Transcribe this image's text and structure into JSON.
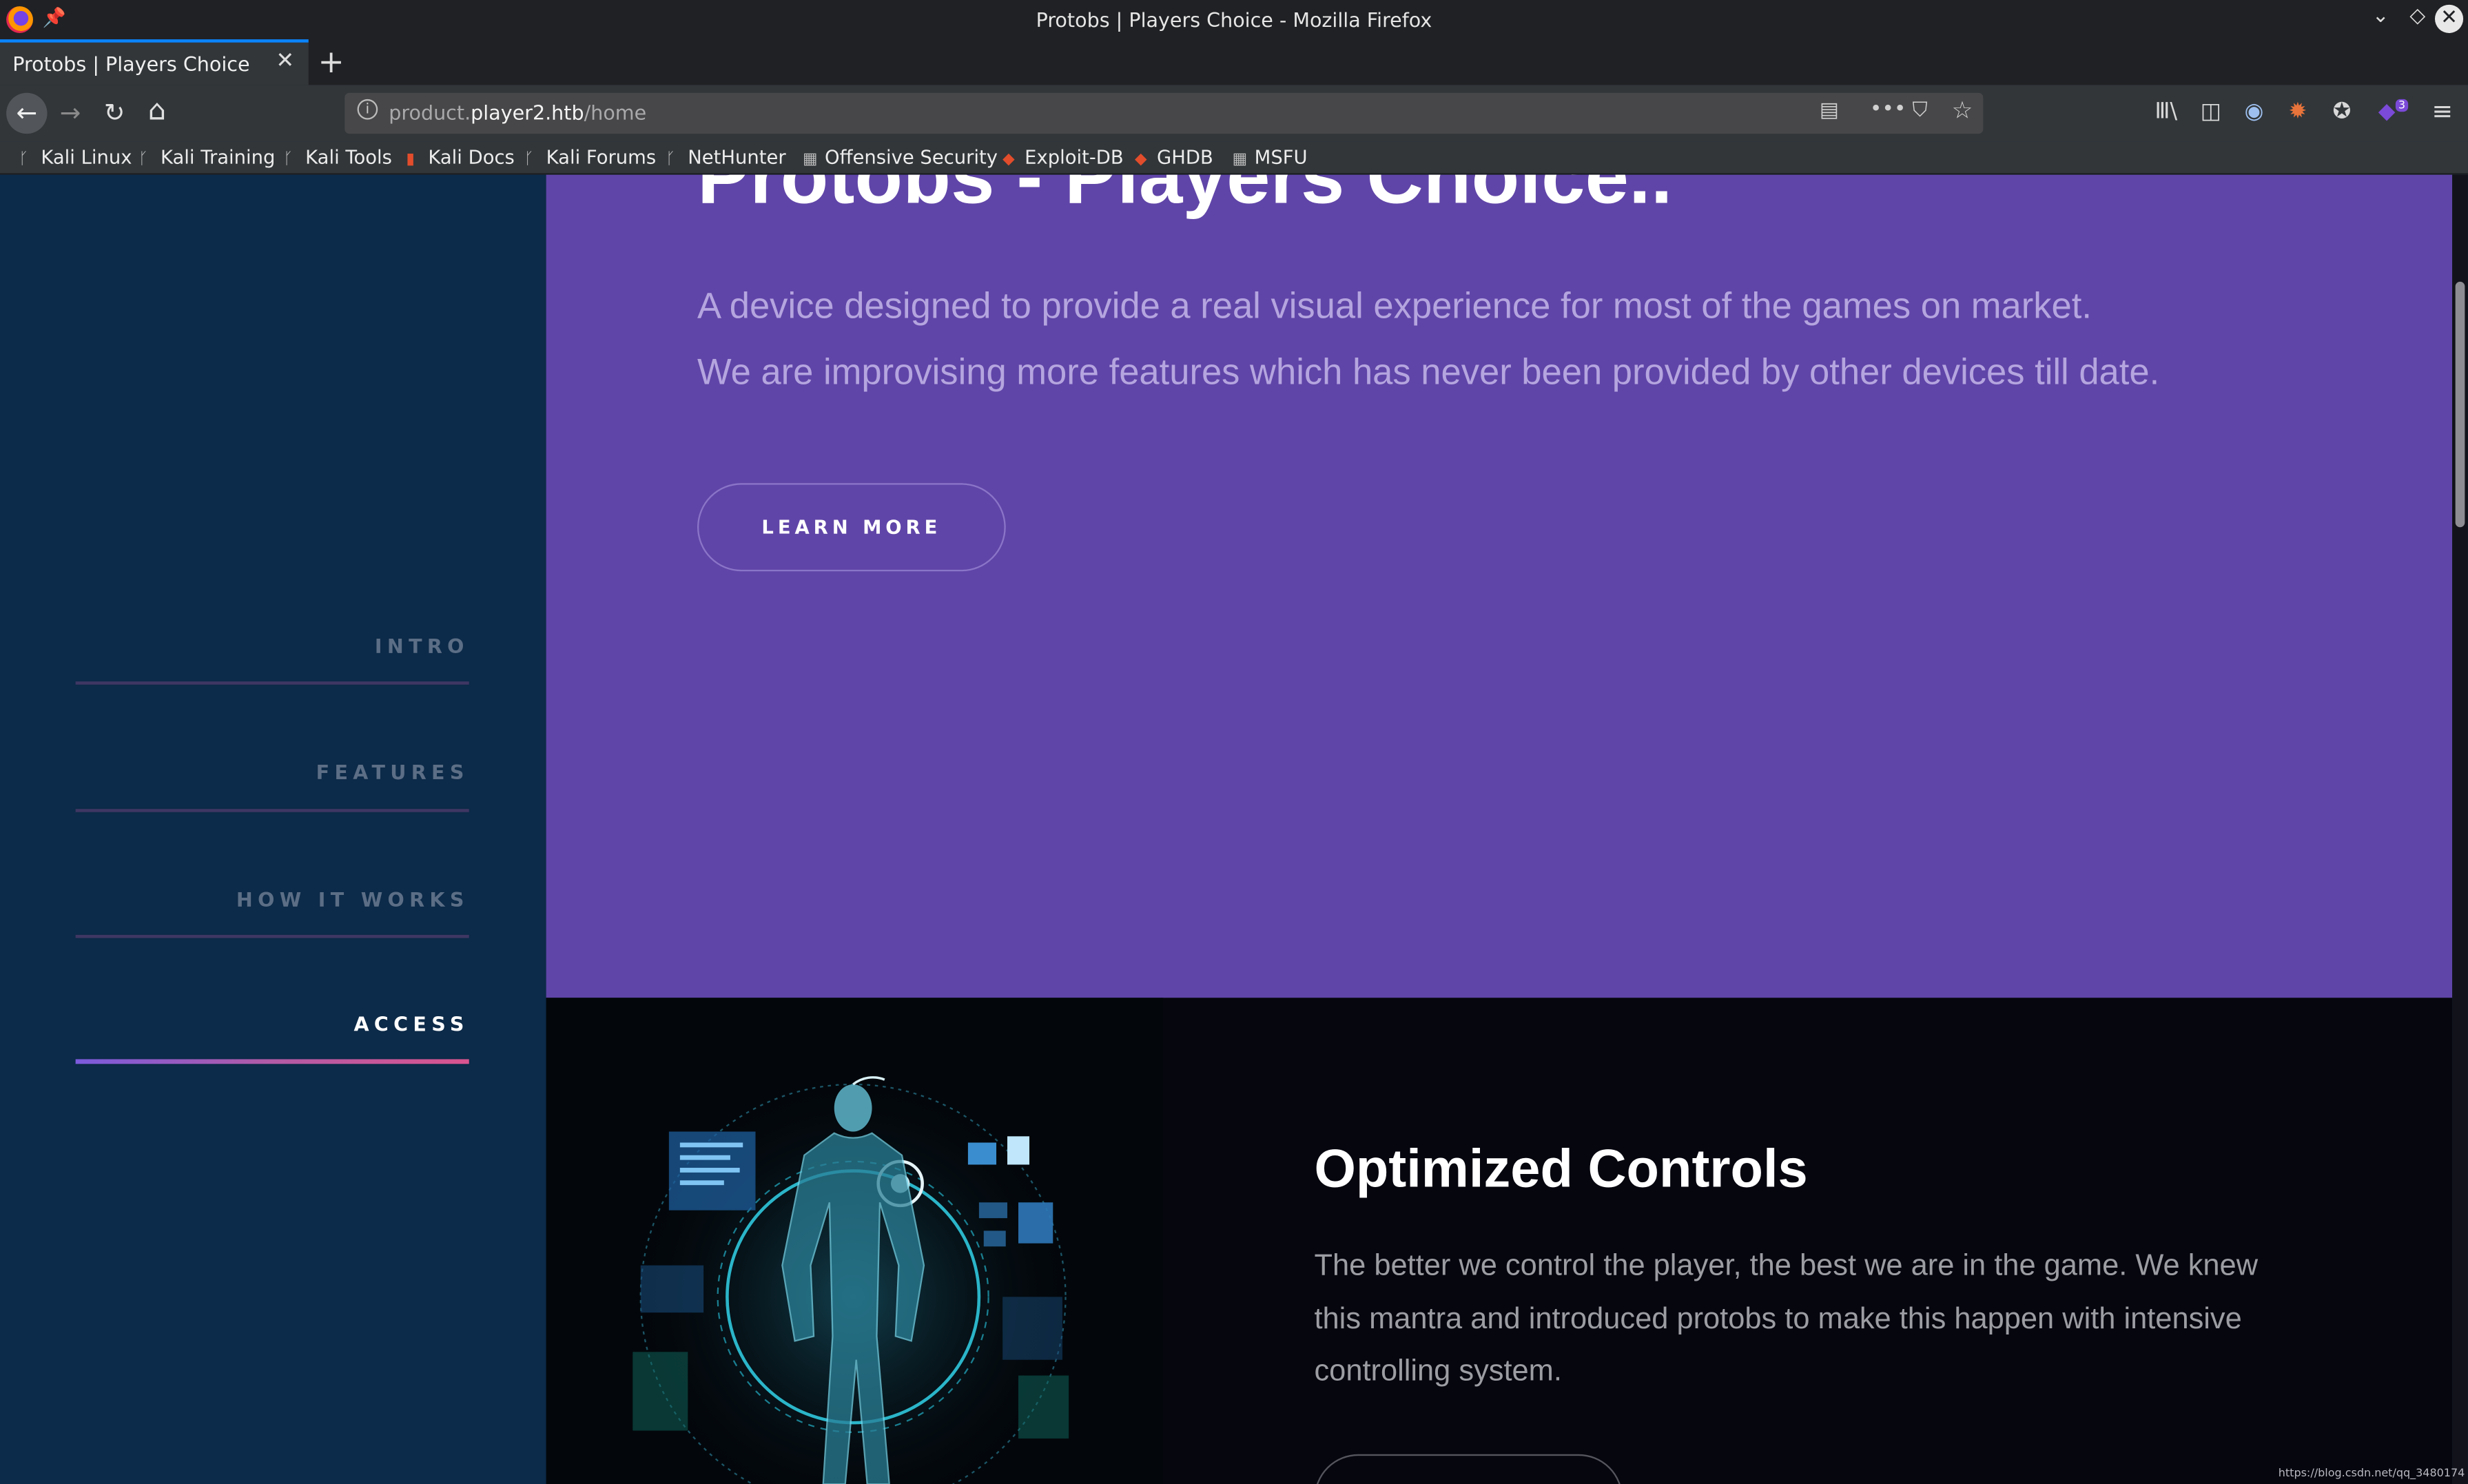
{
  "window": {
    "title": "Protobs | Players Choice - Mozilla Firefox"
  },
  "tab": {
    "label": "Protobs | Players Choice",
    "close": "✕",
    "new_tab": "+"
  },
  "nav": {
    "back": "←",
    "forward": "→",
    "reload": "↻",
    "home": "⌂",
    "info": "i",
    "url_domain_prefix": "product.",
    "url_domain": "player2.htb",
    "url_path": "/home",
    "reader": "▤",
    "more": "•••",
    "pocket": "⛉",
    "star": "☆",
    "library": "Ⅲ\\",
    "sidebar_toggle": "◫",
    "account": "◉",
    "ext1": "✹",
    "ext2": "✪",
    "ext3": "◆",
    "ext3_badge": "3",
    "menu": "≡"
  },
  "bookmarks": [
    {
      "label": "Kali Linux",
      "icon": "dragon-icon"
    },
    {
      "label": "Kali Training",
      "icon": "dragon-icon"
    },
    {
      "label": "Kali Tools",
      "icon": "dragon-icon"
    },
    {
      "label": "Kali Docs",
      "icon": "docs-icon"
    },
    {
      "label": "Kali Forums",
      "icon": "dragon-icon"
    },
    {
      "label": "NetHunter",
      "icon": "dragon-icon"
    },
    {
      "label": "Offensive Security",
      "icon": "offsec-icon"
    },
    {
      "label": "Exploit-DB",
      "icon": "exploitdb-icon"
    },
    {
      "label": "GHDB",
      "icon": "ghdb-icon"
    },
    {
      "label": "MSFU",
      "icon": "offsec-icon"
    }
  ],
  "sidebar": {
    "items": [
      {
        "label": "INTRO",
        "active": false
      },
      {
        "label": "FEATURES",
        "active": false
      },
      {
        "label": "HOW IT WORKS",
        "active": false
      },
      {
        "label": "ACCESS",
        "active": true
      }
    ]
  },
  "hero": {
    "title": "Protobs - Players Choice..",
    "line1": "A device designed to provide a real visual experience for most of the games on market.",
    "line2": "We are improvising more features which has never been provided by other devices till date.",
    "button": "LEARN MORE"
  },
  "features": {
    "title": "Optimized Controls",
    "text": "The better we control the player, the best we are in the game. We knew this mantra and introduced protobs to make this happen with intensive controlling system."
  },
  "status": {
    "url": "https://blog.csdn.net/qq_3480174"
  },
  "colors": {
    "sidebar_bg": "#0c2a49",
    "hero_bg": "#6045a8",
    "features_bg": "#06060f",
    "accent": "#d9548f"
  }
}
